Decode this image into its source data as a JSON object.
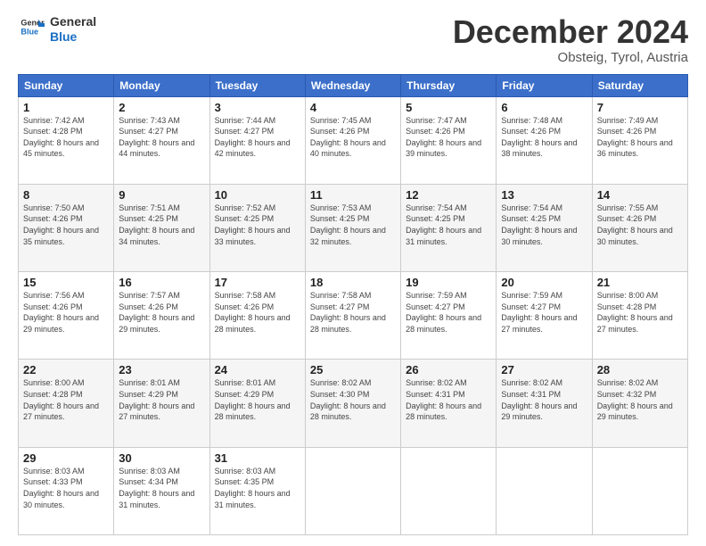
{
  "header": {
    "logo_line1": "General",
    "logo_line2": "Blue",
    "month": "December 2024",
    "location": "Obsteig, Tyrol, Austria"
  },
  "weekdays": [
    "Sunday",
    "Monday",
    "Tuesday",
    "Wednesday",
    "Thursday",
    "Friday",
    "Saturday"
  ],
  "weeks": [
    [
      {
        "day": "1",
        "sunrise": "Sunrise: 7:42 AM",
        "sunset": "Sunset: 4:28 PM",
        "daylight": "Daylight: 8 hours and 45 minutes."
      },
      {
        "day": "2",
        "sunrise": "Sunrise: 7:43 AM",
        "sunset": "Sunset: 4:27 PM",
        "daylight": "Daylight: 8 hours and 44 minutes."
      },
      {
        "day": "3",
        "sunrise": "Sunrise: 7:44 AM",
        "sunset": "Sunset: 4:27 PM",
        "daylight": "Daylight: 8 hours and 42 minutes."
      },
      {
        "day": "4",
        "sunrise": "Sunrise: 7:45 AM",
        "sunset": "Sunset: 4:26 PM",
        "daylight": "Daylight: 8 hours and 40 minutes."
      },
      {
        "day": "5",
        "sunrise": "Sunrise: 7:47 AM",
        "sunset": "Sunset: 4:26 PM",
        "daylight": "Daylight: 8 hours and 39 minutes."
      },
      {
        "day": "6",
        "sunrise": "Sunrise: 7:48 AM",
        "sunset": "Sunset: 4:26 PM",
        "daylight": "Daylight: 8 hours and 38 minutes."
      },
      {
        "day": "7",
        "sunrise": "Sunrise: 7:49 AM",
        "sunset": "Sunset: 4:26 PM",
        "daylight": "Daylight: 8 hours and 36 minutes."
      }
    ],
    [
      {
        "day": "8",
        "sunrise": "Sunrise: 7:50 AM",
        "sunset": "Sunset: 4:26 PM",
        "daylight": "Daylight: 8 hours and 35 minutes."
      },
      {
        "day": "9",
        "sunrise": "Sunrise: 7:51 AM",
        "sunset": "Sunset: 4:25 PM",
        "daylight": "Daylight: 8 hours and 34 minutes."
      },
      {
        "day": "10",
        "sunrise": "Sunrise: 7:52 AM",
        "sunset": "Sunset: 4:25 PM",
        "daylight": "Daylight: 8 hours and 33 minutes."
      },
      {
        "day": "11",
        "sunrise": "Sunrise: 7:53 AM",
        "sunset": "Sunset: 4:25 PM",
        "daylight": "Daylight: 8 hours and 32 minutes."
      },
      {
        "day": "12",
        "sunrise": "Sunrise: 7:54 AM",
        "sunset": "Sunset: 4:25 PM",
        "daylight": "Daylight: 8 hours and 31 minutes."
      },
      {
        "day": "13",
        "sunrise": "Sunrise: 7:54 AM",
        "sunset": "Sunset: 4:25 PM",
        "daylight": "Daylight: 8 hours and 30 minutes."
      },
      {
        "day": "14",
        "sunrise": "Sunrise: 7:55 AM",
        "sunset": "Sunset: 4:26 PM",
        "daylight": "Daylight: 8 hours and 30 minutes."
      }
    ],
    [
      {
        "day": "15",
        "sunrise": "Sunrise: 7:56 AM",
        "sunset": "Sunset: 4:26 PM",
        "daylight": "Daylight: 8 hours and 29 minutes."
      },
      {
        "day": "16",
        "sunrise": "Sunrise: 7:57 AM",
        "sunset": "Sunset: 4:26 PM",
        "daylight": "Daylight: 8 hours and 29 minutes."
      },
      {
        "day": "17",
        "sunrise": "Sunrise: 7:58 AM",
        "sunset": "Sunset: 4:26 PM",
        "daylight": "Daylight: 8 hours and 28 minutes."
      },
      {
        "day": "18",
        "sunrise": "Sunrise: 7:58 AM",
        "sunset": "Sunset: 4:27 PM",
        "daylight": "Daylight: 8 hours and 28 minutes."
      },
      {
        "day": "19",
        "sunrise": "Sunrise: 7:59 AM",
        "sunset": "Sunset: 4:27 PM",
        "daylight": "Daylight: 8 hours and 28 minutes."
      },
      {
        "day": "20",
        "sunrise": "Sunrise: 7:59 AM",
        "sunset": "Sunset: 4:27 PM",
        "daylight": "Daylight: 8 hours and 27 minutes."
      },
      {
        "day": "21",
        "sunrise": "Sunrise: 8:00 AM",
        "sunset": "Sunset: 4:28 PM",
        "daylight": "Daylight: 8 hours and 27 minutes."
      }
    ],
    [
      {
        "day": "22",
        "sunrise": "Sunrise: 8:00 AM",
        "sunset": "Sunset: 4:28 PM",
        "daylight": "Daylight: 8 hours and 27 minutes."
      },
      {
        "day": "23",
        "sunrise": "Sunrise: 8:01 AM",
        "sunset": "Sunset: 4:29 PM",
        "daylight": "Daylight: 8 hours and 27 minutes."
      },
      {
        "day": "24",
        "sunrise": "Sunrise: 8:01 AM",
        "sunset": "Sunset: 4:29 PM",
        "daylight": "Daylight: 8 hours and 28 minutes."
      },
      {
        "day": "25",
        "sunrise": "Sunrise: 8:02 AM",
        "sunset": "Sunset: 4:30 PM",
        "daylight": "Daylight: 8 hours and 28 minutes."
      },
      {
        "day": "26",
        "sunrise": "Sunrise: 8:02 AM",
        "sunset": "Sunset: 4:31 PM",
        "daylight": "Daylight: 8 hours and 28 minutes."
      },
      {
        "day": "27",
        "sunrise": "Sunrise: 8:02 AM",
        "sunset": "Sunset: 4:31 PM",
        "daylight": "Daylight: 8 hours and 29 minutes."
      },
      {
        "day": "28",
        "sunrise": "Sunrise: 8:02 AM",
        "sunset": "Sunset: 4:32 PM",
        "daylight": "Daylight: 8 hours and 29 minutes."
      }
    ],
    [
      {
        "day": "29",
        "sunrise": "Sunrise: 8:03 AM",
        "sunset": "Sunset: 4:33 PM",
        "daylight": "Daylight: 8 hours and 30 minutes."
      },
      {
        "day": "30",
        "sunrise": "Sunrise: 8:03 AM",
        "sunset": "Sunset: 4:34 PM",
        "daylight": "Daylight: 8 hours and 31 minutes."
      },
      {
        "day": "31",
        "sunrise": "Sunrise: 8:03 AM",
        "sunset": "Sunset: 4:35 PM",
        "daylight": "Daylight: 8 hours and 31 minutes."
      },
      null,
      null,
      null,
      null
    ]
  ]
}
